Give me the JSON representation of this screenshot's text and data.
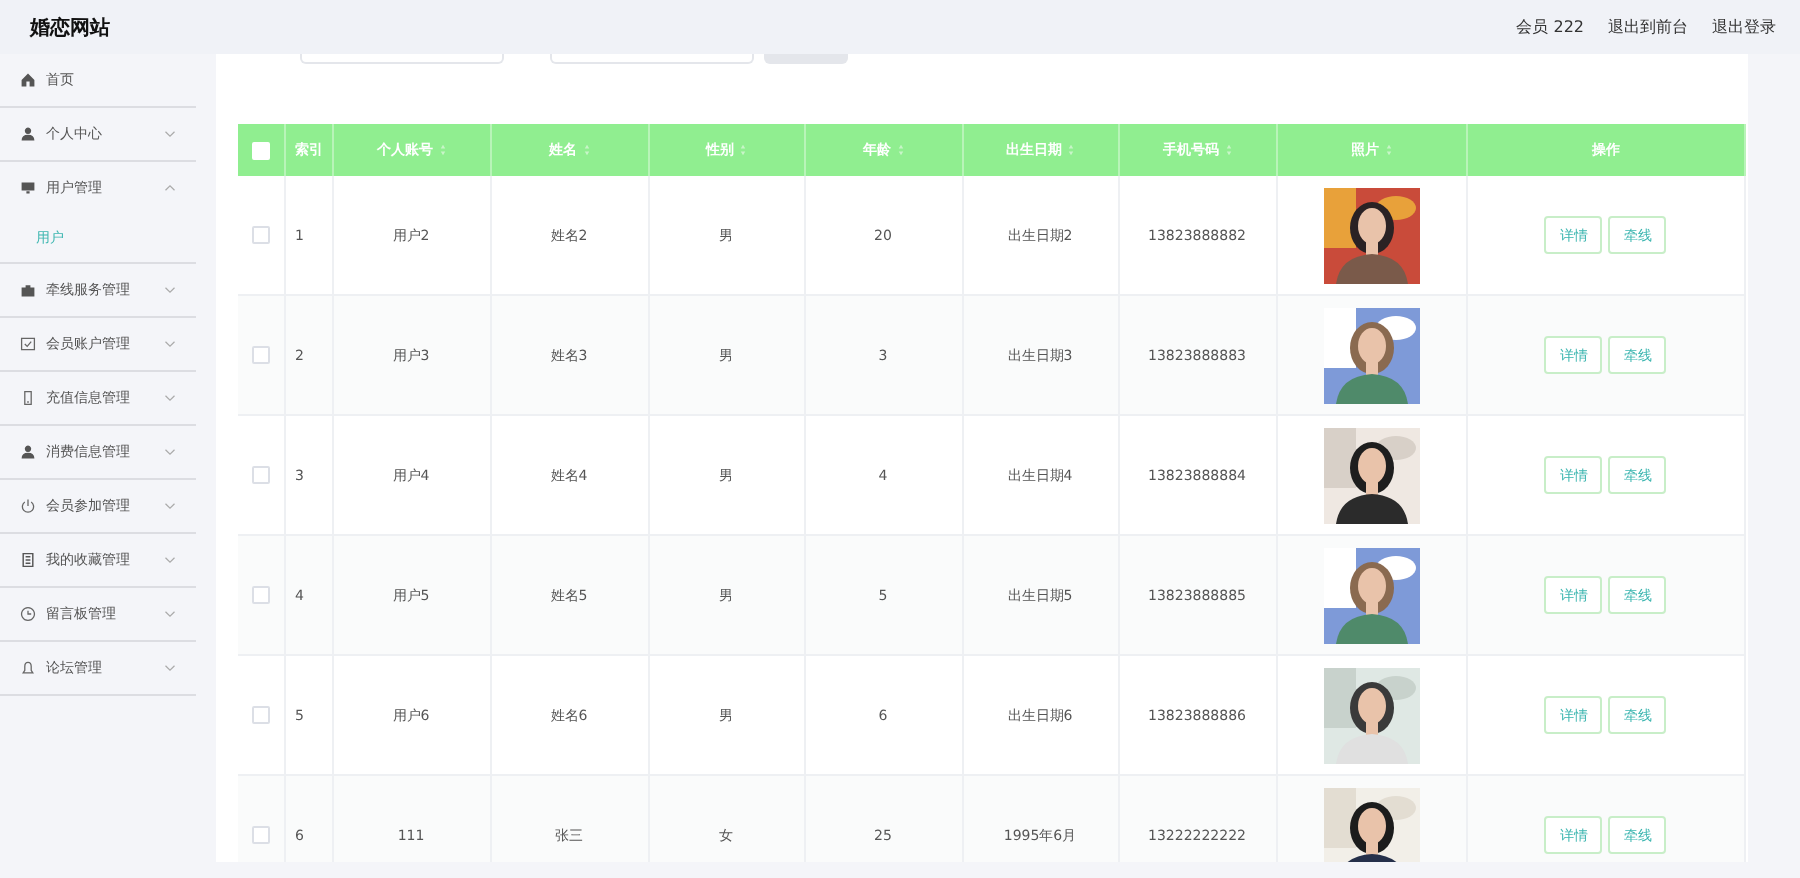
{
  "header": {
    "title": "婚恋网站",
    "links": [
      "会员 222",
      "退出到前台",
      "退出登录"
    ]
  },
  "sidebar": {
    "items": [
      {
        "label": "首页"
      },
      {
        "label": "个人中心",
        "expanded": false
      },
      {
        "label": "用户管理",
        "expanded": true,
        "children": [
          {
            "label": "用户",
            "selected": true
          }
        ]
      },
      {
        "label": "牵线服务管理",
        "expanded": false
      },
      {
        "label": "会员账户管理",
        "expanded": false
      },
      {
        "label": "充值信息管理",
        "expanded": false
      },
      {
        "label": "消费信息管理",
        "expanded": false
      },
      {
        "label": "会员参加管理",
        "expanded": false
      },
      {
        "label": "我的收藏管理",
        "expanded": false
      },
      {
        "label": "留言板管理",
        "expanded": false
      },
      {
        "label": "论坛管理",
        "expanded": false
      }
    ]
  },
  "table": {
    "select_all": false,
    "columns": [
      {
        "label": "索引",
        "sortable": false
      },
      {
        "label": "个人账号",
        "sortable": true
      },
      {
        "label": "姓名",
        "sortable": true
      },
      {
        "label": "性别",
        "sortable": true
      },
      {
        "label": "年龄",
        "sortable": true
      },
      {
        "label": "出生日期",
        "sortable": true
      },
      {
        "label": "手机号码",
        "sortable": true
      },
      {
        "label": "照片",
        "sortable": true
      },
      {
        "label": "操作",
        "sortable": false
      }
    ],
    "rows": [
      {
        "checked": false,
        "cells": [
          "1",
          "用户2",
          "姓名2",
          "男",
          "20",
          "出生日期2",
          "13823888882"
        ],
        "photo": {
          "kind": "picture"
        },
        "actions": [
          "详情",
          "牵线"
        ]
      },
      {
        "checked": false,
        "cells": [
          "2",
          "用户3",
          "姓名3",
          "男",
          "3",
          "出生日期3",
          "13823888883"
        ],
        "photo": {
          "kind": "picture"
        },
        "actions": [
          "详情",
          "牵线"
        ]
      },
      {
        "checked": false,
        "cells": [
          "3",
          "用户4",
          "姓名4",
          "男",
          "4",
          "出生日期4",
          "13823888884"
        ],
        "photo": {
          "kind": "picture"
        },
        "actions": [
          "详情",
          "牵线"
        ]
      },
      {
        "checked": false,
        "cells": [
          "4",
          "用户5",
          "姓名5",
          "男",
          "5",
          "出生日期5",
          "13823888885"
        ],
        "photo": {
          "kind": "picture"
        },
        "actions": [
          "详情",
          "牵线"
        ]
      },
      {
        "checked": false,
        "cells": [
          "5",
          "用户6",
          "姓名6",
          "男",
          "6",
          "出生日期6",
          "13823888886"
        ],
        "photo": {
          "kind": "picture"
        },
        "actions": [
          "详情",
          "牵线"
        ]
      },
      {
        "checked": false,
        "cells": [
          "6",
          "111",
          "张三",
          "女",
          "25",
          "1995年6月",
          "13222222222"
        ],
        "photo": {
          "kind": "picture"
        },
        "actions": [
          "详情",
          "牵线"
        ]
      }
    ]
  }
}
